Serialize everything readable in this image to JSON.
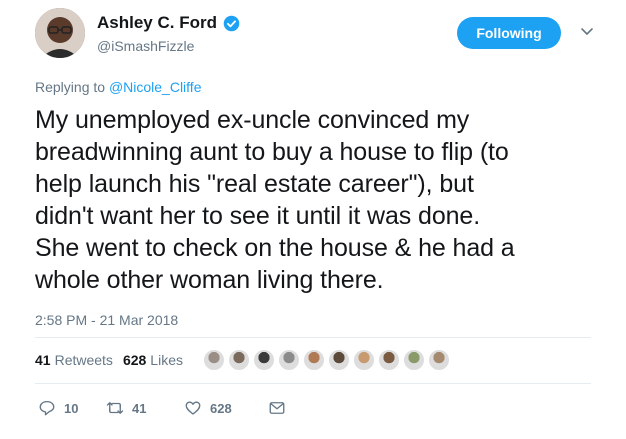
{
  "author": {
    "display_name": "Ashley C. Ford",
    "handle": "@iSmashFizzle",
    "verified": true
  },
  "follow_button": {
    "label": "Following"
  },
  "reply": {
    "prefix": "Replying to ",
    "mention": "@Nicole_Cliffe"
  },
  "tweet": {
    "lines": [
      "My unemployed ex-uncle convinced my",
      "breadwinning aunt to buy a house to flip (to",
      "help launch his \"real estate career\"), but",
      "didn't want her to see it until it was done.",
      "She went to check on the house & he had a",
      "whole other woman living there."
    ],
    "timestamp": "2:58 PM - 21 Mar 2018"
  },
  "stats": {
    "retweets_count": "41",
    "retweets_label": "Retweets",
    "likes_count": "628",
    "likes_label": "Likes"
  },
  "actions": {
    "replies": "10",
    "retweets": "41",
    "likes": "628"
  },
  "colors": {
    "accent": "#1da1f2",
    "muted": "#657786",
    "text": "#14171a"
  },
  "liker_avatar_colors": [
    "#9a8f86",
    "#7a6a5c",
    "#3a3a3a",
    "#8b8b8b",
    "#b07a55",
    "#5c4a3a",
    "#c89a70",
    "#7a5a40",
    "#8a9a6a",
    "#a58a70"
  ]
}
